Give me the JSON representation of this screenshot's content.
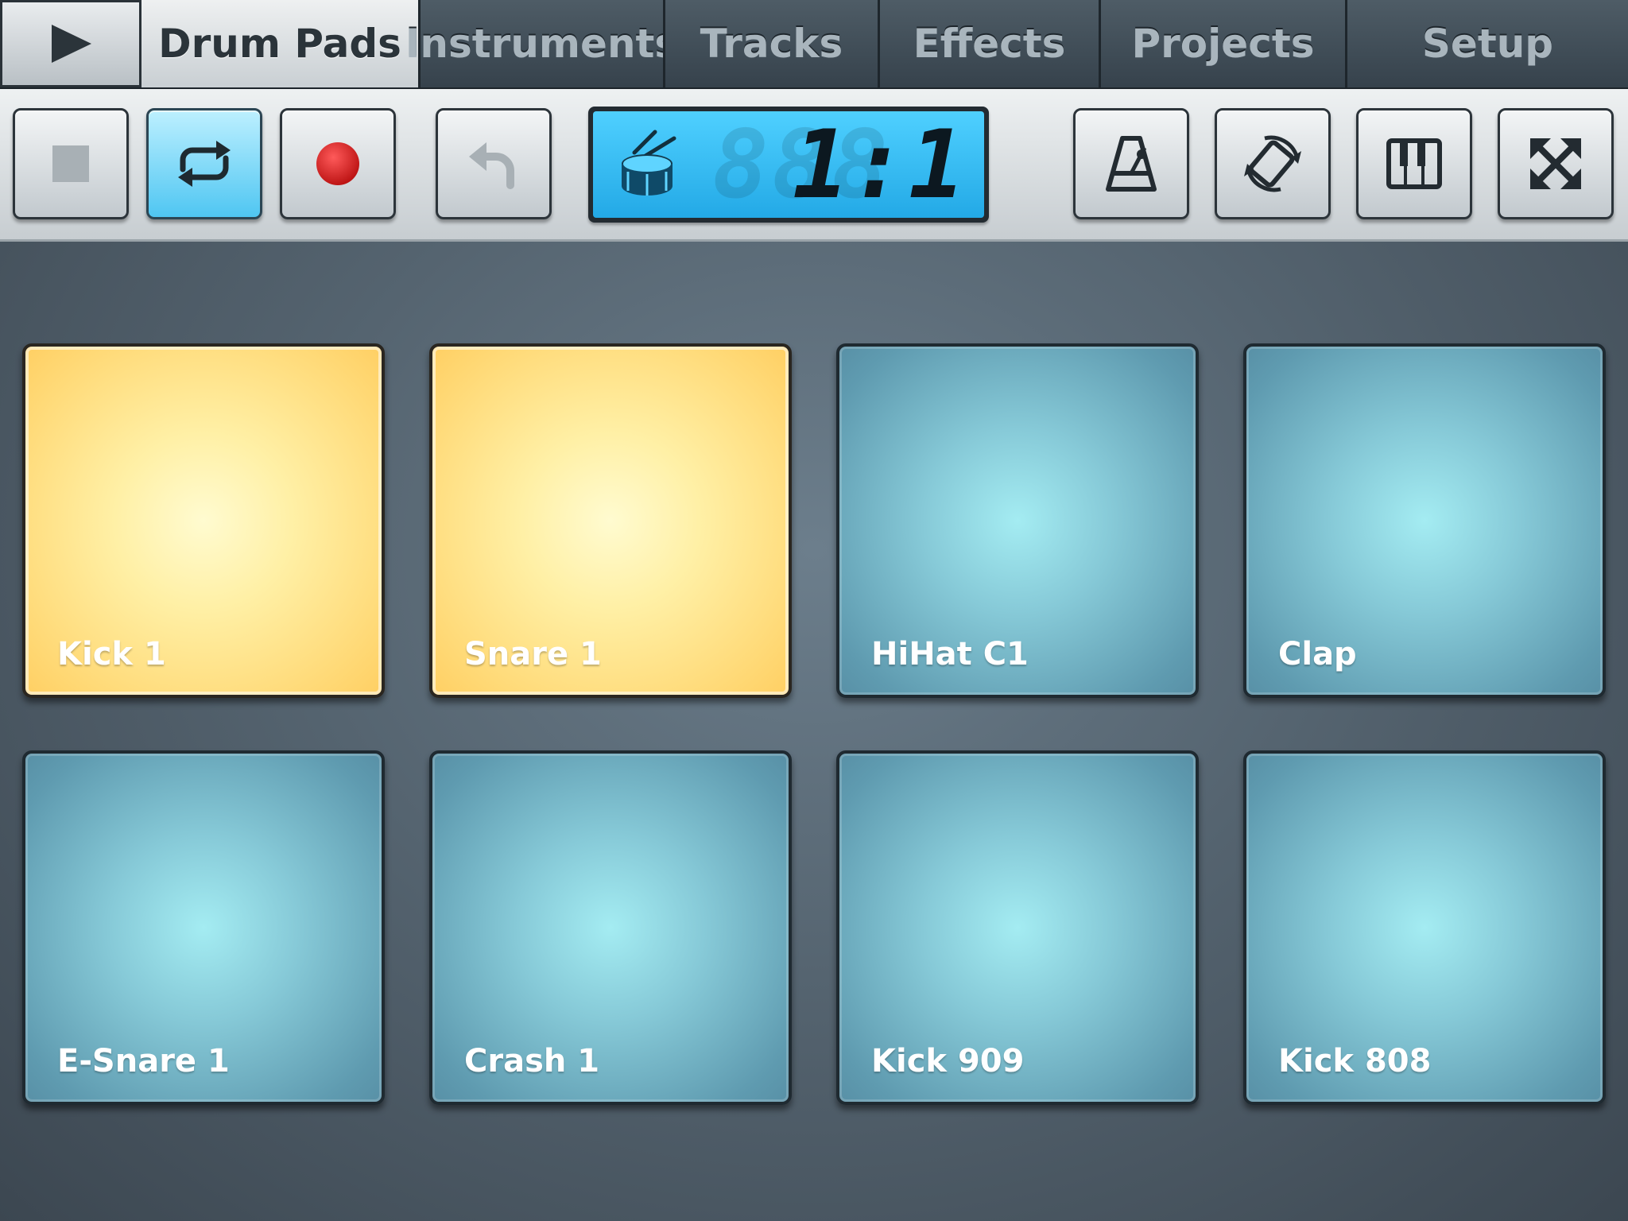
{
  "tabs": {
    "play_icon": "play-icon",
    "items": [
      {
        "label": "Drum Pads",
        "active": true
      },
      {
        "label": "Instruments",
        "active": false
      },
      {
        "label": "Tracks",
        "active": false
      },
      {
        "label": "Effects",
        "active": false
      },
      {
        "label": "Projects",
        "active": false
      },
      {
        "label": "Setup",
        "active": false
      }
    ]
  },
  "toolbar": {
    "buttons": [
      {
        "name": "stop",
        "icon": "stop-icon",
        "active": false
      },
      {
        "name": "loop",
        "icon": "loop-icon",
        "active": true
      },
      {
        "name": "record",
        "icon": "record-icon",
        "active": false
      },
      {
        "name": "undo",
        "icon": "undo-icon",
        "active": false
      },
      {
        "name": "metronome",
        "icon": "metronome-icon",
        "active": false
      },
      {
        "name": "rotate",
        "icon": "rotate-icon",
        "active": false
      },
      {
        "name": "keyboard",
        "icon": "piano-keys-icon",
        "active": false
      },
      {
        "name": "fullscreen",
        "icon": "expand-icon",
        "active": false
      }
    ],
    "display": {
      "icon": "drum-icon",
      "position": "1:1"
    }
  },
  "pads": [
    {
      "label": "Kick 1",
      "state": "lit"
    },
    {
      "label": "Snare 1",
      "state": "lit"
    },
    {
      "label": "HiHat C1",
      "state": "idle"
    },
    {
      "label": "Clap",
      "state": "idle"
    },
    {
      "label": "E-Snare 1",
      "state": "idle"
    },
    {
      "label": "Crash 1",
      "state": "idle"
    },
    {
      "label": "Kick 909",
      "state": "idle"
    },
    {
      "label": "Kick 808",
      "state": "idle"
    }
  ],
  "colors": {
    "pad_lit": "#ffe58c",
    "pad_idle": "#7fbccb",
    "lcd": "#3fc2f5",
    "record": "#d01c1c"
  }
}
